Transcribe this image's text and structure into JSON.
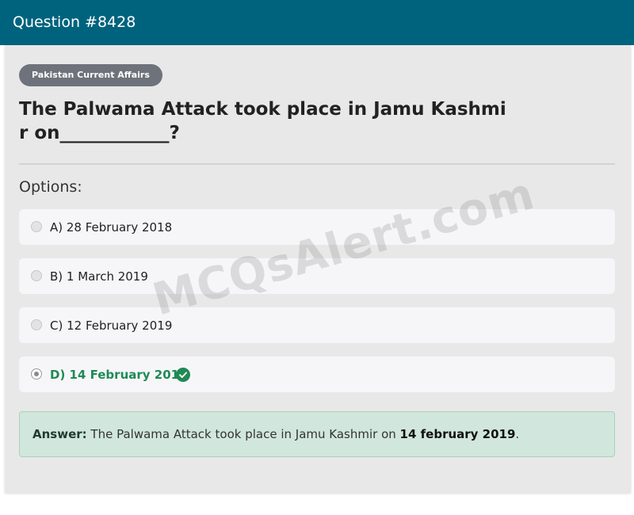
{
  "header": {
    "title": "Question #8428"
  },
  "category": "Pakistan Current Affairs",
  "question": "The Palwama Attack took place in Jamu Kashmir on____________?",
  "options_label": "Options:",
  "options": [
    {
      "text": "A) 28 February 2018",
      "selected": false,
      "correct": false
    },
    {
      "text": "B) 1 March 2019",
      "selected": false,
      "correct": false
    },
    {
      "text": "C) 12 February 2019",
      "selected": false,
      "correct": false
    },
    {
      "text": "D) 14 February 2019",
      "selected": true,
      "correct": true
    }
  ],
  "answer": {
    "label": "Answer:",
    "text": " The Palwama Attack took place in Jamu Kashmir on ",
    "value": "14 february 2019",
    "suffix": "."
  },
  "watermark": "MCQsAlert.com",
  "colors": {
    "header_bg": "#00637e",
    "correct": "#1f8a55",
    "answer_bg": "#d1e6dc",
    "badge_bg": "#6e737b"
  },
  "icons": {
    "correct_option": "check-circle-icon",
    "option_selector": "radio-icon"
  }
}
